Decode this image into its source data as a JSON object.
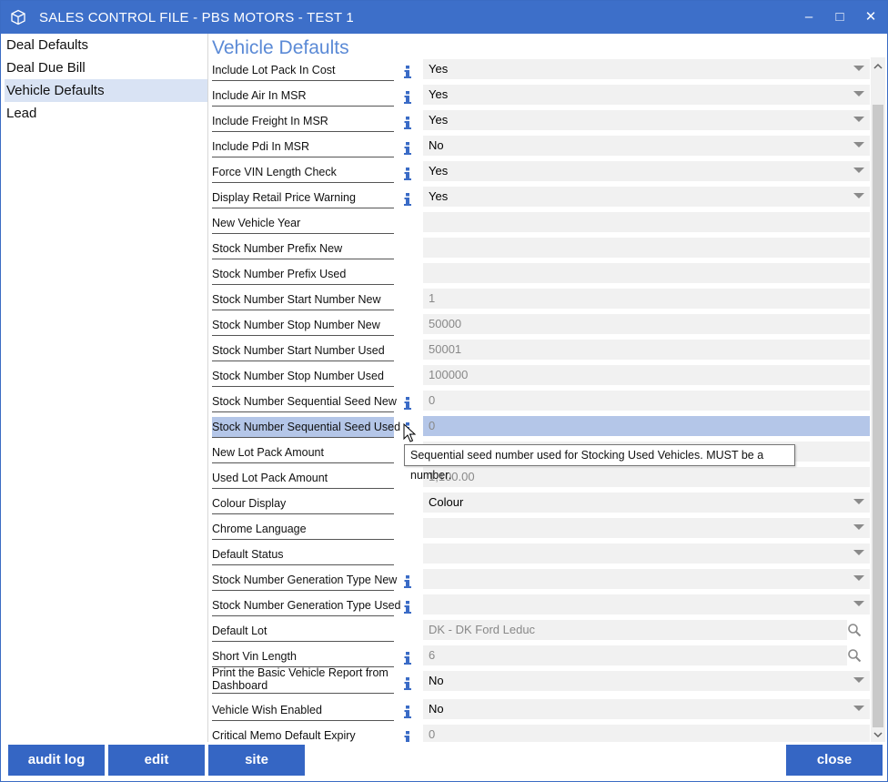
{
  "window": {
    "title": "SALES CONTROL FILE - PBS MOTORS - TEST 1",
    "minimize": "–",
    "maximize": "□",
    "close": "✕"
  },
  "sidebar": {
    "items": [
      {
        "label": "Deal Defaults"
      },
      {
        "label": "Deal Due Bill"
      },
      {
        "label": "Vehicle Defaults"
      },
      {
        "label": "Lead"
      }
    ]
  },
  "heading": "Vehicle Defaults",
  "rows": [
    {
      "label": "Include Lot Pack In Cost",
      "info": true,
      "value": "Yes",
      "type": "dropdown"
    },
    {
      "label": "Include Air In MSR",
      "info": true,
      "value": "Yes",
      "type": "dropdown"
    },
    {
      "label": "Include Freight In MSR",
      "info": true,
      "value": "Yes",
      "type": "dropdown"
    },
    {
      "label": "Include Pdi In MSR",
      "info": true,
      "value": "No",
      "type": "dropdown"
    },
    {
      "label": "Force VIN Length Check",
      "info": true,
      "value": "Yes",
      "type": "dropdown"
    },
    {
      "label": "Display Retail Price Warning",
      "info": true,
      "value": "Yes",
      "type": "dropdown"
    },
    {
      "label": "New Vehicle Year",
      "info": false,
      "value": "",
      "type": "text"
    },
    {
      "label": "Stock Number Prefix New",
      "info": false,
      "value": "",
      "type": "text"
    },
    {
      "label": "Stock Number Prefix Used",
      "info": false,
      "value": "",
      "type": "text"
    },
    {
      "label": "Stock Number Start Number New",
      "info": false,
      "value": "1",
      "type": "text"
    },
    {
      "label": "Stock Number Stop Number New",
      "info": false,
      "value": "50000",
      "type": "text"
    },
    {
      "label": "Stock Number Start Number Used",
      "info": false,
      "value": "50001",
      "type": "text"
    },
    {
      "label": "Stock Number Stop Number Used",
      "info": false,
      "value": "100000",
      "type": "text"
    },
    {
      "label": "Stock Number Sequential Seed New",
      "info": true,
      "value": "0",
      "type": "text"
    },
    {
      "label": "Stock Number Sequential Seed Used",
      "info": true,
      "value": "0",
      "type": "text",
      "selected": true
    },
    {
      "label": "New Lot Pack Amount",
      "info": false,
      "value": "",
      "type": "text"
    },
    {
      "label": "Used Lot Pack Amount",
      "info": false,
      "value": "1,100.00",
      "type": "text"
    },
    {
      "label": "Colour Display",
      "info": false,
      "value": "Colour",
      "type": "dropdown"
    },
    {
      "label": "Chrome Language",
      "info": false,
      "value": "",
      "type": "dropdown"
    },
    {
      "label": "Default Status",
      "info": false,
      "value": "",
      "type": "dropdown"
    },
    {
      "label": "Stock Number Generation Type New",
      "info": true,
      "value": "",
      "type": "dropdown"
    },
    {
      "label": "Stock Number Generation Type Used",
      "info": true,
      "value": "",
      "type": "dropdown"
    },
    {
      "label": "Default Lot",
      "info": false,
      "value": "DK - DK Ford Leduc",
      "type": "lookup"
    },
    {
      "label": "Short Vin Length",
      "info": true,
      "value": "6",
      "type": "lookup"
    },
    {
      "label": "Print the Basic Vehicle Report from Dashboard",
      "info": true,
      "value": "No",
      "type": "dropdown"
    },
    {
      "label": "Vehicle Wish Enabled",
      "info": true,
      "value": "No",
      "type": "dropdown"
    },
    {
      "label": "Critical Memo Default Expiry",
      "info": true,
      "value": "0",
      "type": "text"
    }
  ],
  "tooltip": "Sequential seed number used for Stocking Used Vehicles. MUST be a number.",
  "footer": {
    "audit": "audit log",
    "edit": "edit",
    "site": "site",
    "close": "close"
  },
  "colors": {
    "titlebar": "#3d6fc9",
    "accent_heading": "#5b8ad6",
    "button": "#3566c4",
    "selection": "#b4c6e8",
    "sidebar_active": "#d9e3f4"
  },
  "icons": {
    "app": "cube-icon",
    "info": "info-icon",
    "lookup": "magnifier-icon",
    "dropdown": "chevron-down-icon"
  }
}
